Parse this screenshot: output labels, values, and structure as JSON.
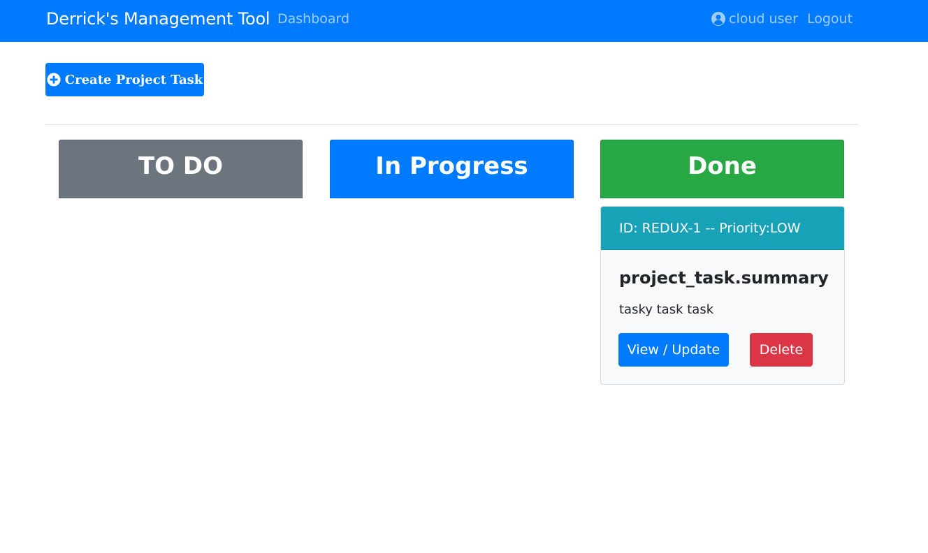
{
  "navbar": {
    "brand": "Derrick's Management Tool",
    "dashboard_link": "Dashboard",
    "user_icon": "user-circle-icon",
    "user_label": "cloud user",
    "logout_link": "Logout",
    "background_color": "#007bff"
  },
  "toolbar": {
    "create_icon": "plus-circle-icon",
    "create_label": "Create Project Task"
  },
  "board": {
    "columns": [
      {
        "label": "TO DO",
        "color": "#6c757d"
      },
      {
        "label": "In Progress",
        "color": "#007bff"
      },
      {
        "label": "Done",
        "color": "#28a745"
      }
    ]
  },
  "tasks": [
    {
      "column": "Done",
      "header": "ID: REDUX-1 -- Priority:LOW",
      "summary": "project_task.summary",
      "description": "tasky task task",
      "view_label": "View / Update",
      "delete_label": "Delete",
      "header_color": "#17a2b8"
    }
  ]
}
